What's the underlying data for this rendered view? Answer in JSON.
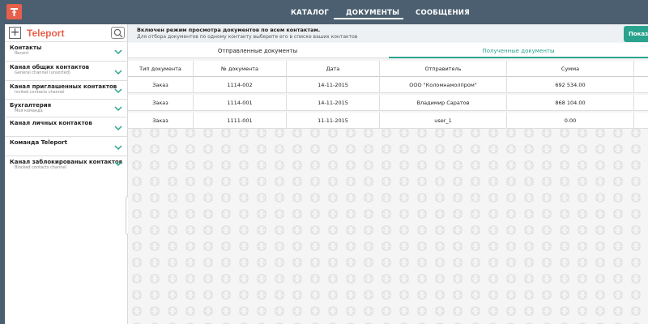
{
  "nav": {
    "catalog": "КАТАЛОГ",
    "documents": "ДОКУМЕНТЫ",
    "messages": "СООБЩЕНИЯ"
  },
  "sidebar": {
    "title": "Teleport",
    "items": [
      {
        "title": "Контакты",
        "subtitle": "Recent"
      },
      {
        "title": "Канал общих контактов",
        "subtitle": "General channel (unsorted)"
      },
      {
        "title": "Канал приглашенных контактов",
        "subtitle": "Invited contacts channel"
      },
      {
        "title": "Бухгалтерия",
        "subtitle": "Моя команда"
      },
      {
        "title": "Канал личных контактов",
        "subtitle": ""
      },
      {
        "title": "Команда Teleport",
        "subtitle": ""
      },
      {
        "title": "Канал заблокированых контактов",
        "subtitle": "Blocked contacts channel"
      }
    ]
  },
  "info": {
    "line1": "Включен режим просмотра документов по всем контактам.",
    "line2": "Для отбора документов по одному контакту выберите его в списке ваших контактов",
    "button": "Показа"
  },
  "tabs": {
    "sent": "Отправленные документы",
    "received": "Полученные документы"
  },
  "table": {
    "headers": [
      "Тип документа",
      "№ документа",
      "Дата",
      "Отправитель",
      "Сумма"
    ],
    "rows": [
      [
        "Заказ",
        "1114-002",
        "14-11-2015",
        "ООО \"Коломнамолпром\"",
        "692 534.00"
      ],
      [
        "Заказ",
        "1114-001",
        "14-11-2015",
        "Владимир Саратов",
        "868 104.00"
      ],
      [
        "Заказ",
        "1111-001",
        "11-11-2015",
        "user_1",
        "0.00"
      ]
    ]
  },
  "colors": {
    "topbar": "#4b5f70",
    "brand": "#e8604c",
    "accent": "#2aa38e"
  }
}
